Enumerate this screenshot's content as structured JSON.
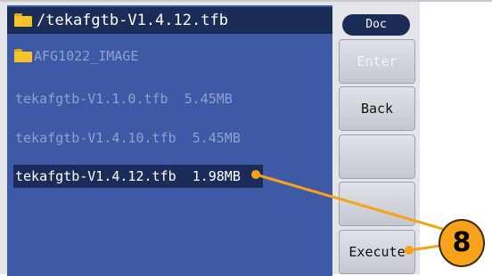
{
  "path_bar": {
    "path": "/tekafgtb-V1.4.12.tfb"
  },
  "file_list": {
    "folder_item": "AFG1022_IMAGE",
    "files": [
      {
        "name": "tekafgtb-V1.1.0.tfb",
        "size": "5.45MB"
      },
      {
        "name": "tekafgtb-V1.4.10.tfb",
        "size": "5.45MB"
      },
      {
        "name": "tekafgtb-V1.4.12.tfb",
        "size": "1.98MB"
      }
    ],
    "selected_index": 2
  },
  "softkeys": {
    "mode_label": "Doc",
    "enter": "Enter",
    "back": "Back",
    "blank1": "",
    "blank2": "",
    "execute": "Execute"
  },
  "callout": {
    "number": "8",
    "color": "#f7a21a"
  },
  "colors": {
    "pane": "#3e5aa6",
    "highlight": "#1c2c59",
    "folder": "#f5c42c",
    "dim_text": "#8ea0cf"
  },
  "icons": {
    "folder": "folder-icon"
  }
}
